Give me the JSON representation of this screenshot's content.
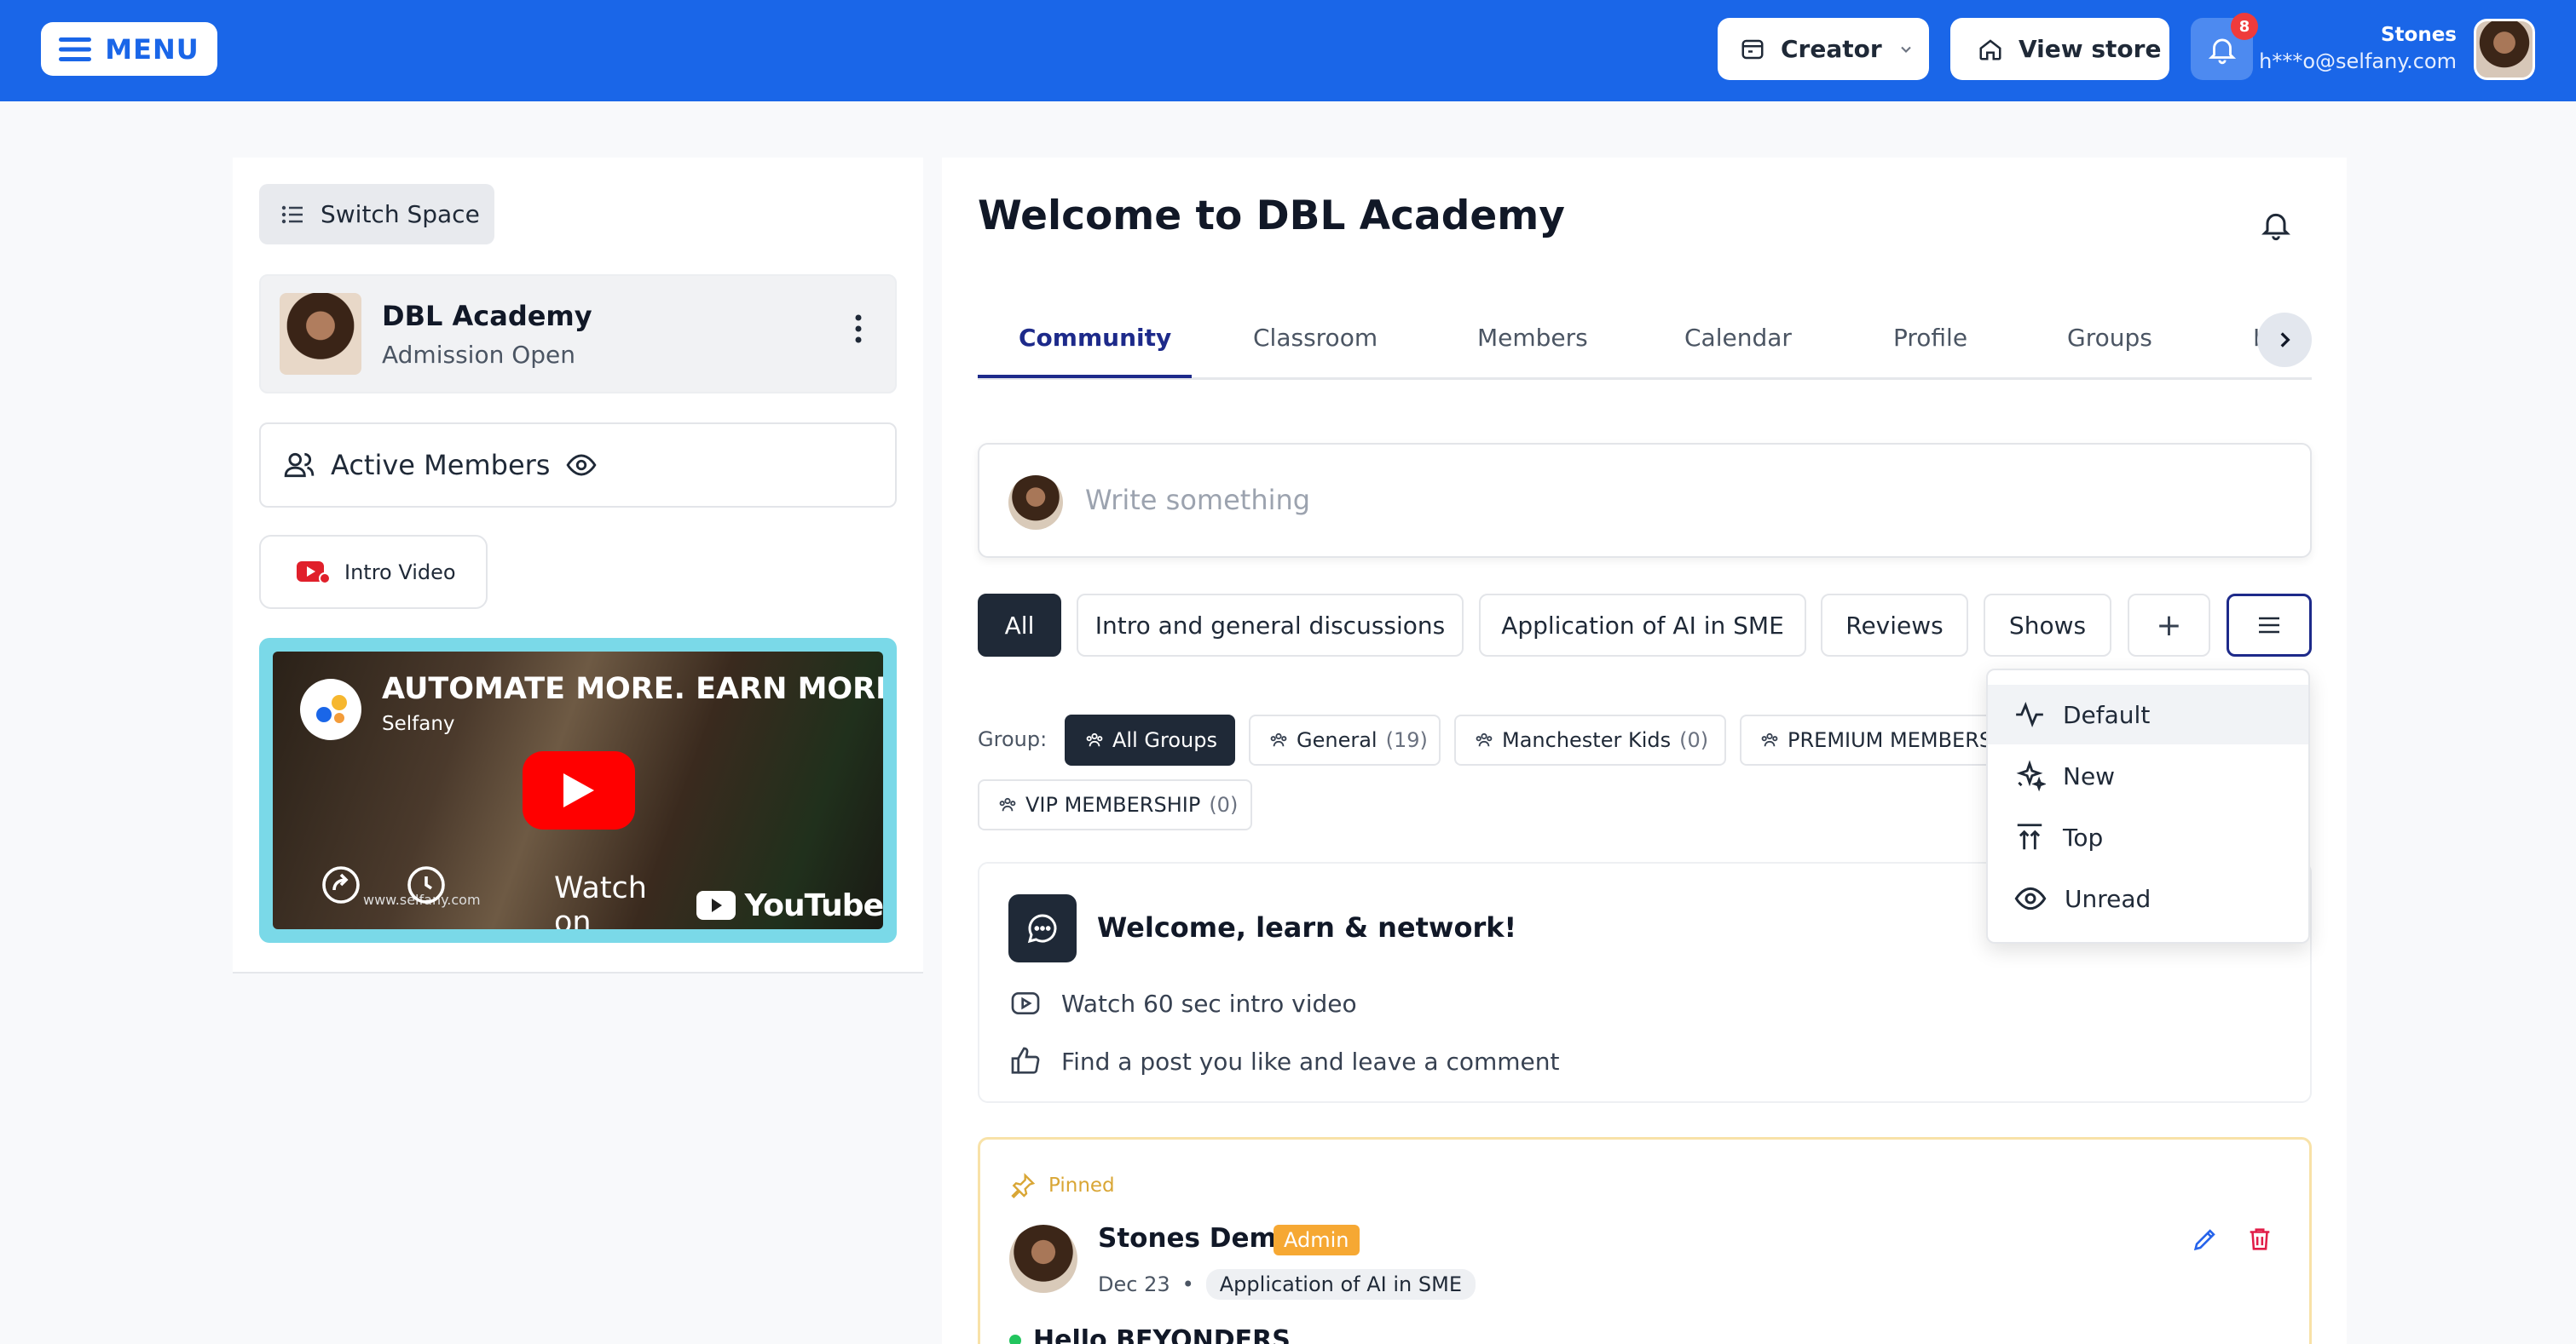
{
  "topbar": {
    "menu_label": "MENU",
    "creator_label": "Creator",
    "view_store_label": "View store",
    "notification_count": "8",
    "user_name": "Stones",
    "user_email": "h***o@selfany.com"
  },
  "sidebar": {
    "switch_space_label": "Switch Space",
    "space_title": "DBL Academy",
    "space_subtitle": "Admission Open",
    "active_members_label": "Active Members",
    "intro_video_label": "Intro Video",
    "video": {
      "title": "AUTOMATE MORE. EARN MORE. K",
      "channel": "Selfany",
      "watch_on": "Watch on",
      "youtube": "YouTube",
      "url_overlay": "www.selfany.com"
    }
  },
  "main": {
    "welcome_title": "Welcome to DBL Academy",
    "tabs": [
      {
        "label": "Community"
      },
      {
        "label": "Classroom"
      },
      {
        "label": "Members"
      },
      {
        "label": "Calendar"
      },
      {
        "label": "Profile"
      },
      {
        "label": "Groups"
      },
      {
        "label": "I"
      }
    ],
    "composer_placeholder": "Write something",
    "categories": [
      {
        "label": "All"
      },
      {
        "label": "Intro and general discussions"
      },
      {
        "label": "Application of AI in SME"
      },
      {
        "label": "Reviews"
      },
      {
        "label": "Shows"
      }
    ],
    "add_category_symbol": "+",
    "group_label": "Group:",
    "groups": [
      {
        "label": "All Groups",
        "count": ""
      },
      {
        "label": "General",
        "count": "(19)"
      },
      {
        "label": "Manchester Kids",
        "count": "(0)"
      },
      {
        "label": "PREMIUM MEMBERS",
        "count": ""
      },
      {
        "label": "VIP MEMBERSHIP",
        "count": "(0)"
      }
    ],
    "sort_menu": [
      {
        "label": "Default",
        "icon": "activity-icon"
      },
      {
        "label": "New",
        "icon": "sparkle-icon"
      },
      {
        "label": "Top",
        "icon": "arrow-up-to-line-icon"
      },
      {
        "label": "Unread",
        "icon": "eye-icon"
      }
    ],
    "welcome_card": {
      "title": "Welcome, learn & network!",
      "items": [
        {
          "label": "Watch 60 sec intro video"
        },
        {
          "label": "Find a post you like and leave a comment"
        }
      ]
    },
    "pinned_post": {
      "pinned_label": "Pinned",
      "author": "Stones Demo",
      "badge": "Admin",
      "date": "Dec 23",
      "separator": "•",
      "category": "Application of AI in SME",
      "title": "Hello BEYONDERS"
    }
  },
  "colors": {
    "brand_blue": "#1a66e8",
    "dark": "#1f2937",
    "tab_active": "#1d2a8a",
    "admin_badge": "#f6a833",
    "pinned_accent": "#d9a635",
    "notification_badge": "#ef3b3b"
  }
}
